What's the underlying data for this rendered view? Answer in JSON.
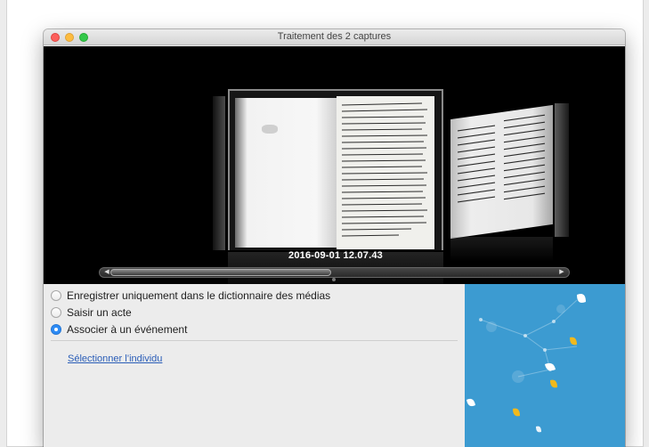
{
  "window": {
    "title": "Traitement des 2 captures"
  },
  "viewer": {
    "date_label": "2016-09-01 12.07.43"
  },
  "options": {
    "items": [
      {
        "label": "Enregistrer uniquement dans le dictionnaire des médias",
        "selected": false
      },
      {
        "label": "Saisir un acte",
        "selected": false
      },
      {
        "label": "Associer à un événement",
        "selected": true
      }
    ],
    "select_link": "Sélectionner l’individu"
  },
  "colors": {
    "accent": "#2d8bf5",
    "illustration_bg": "#3c9bd1",
    "leaf_yellow": "#f1b91c",
    "leaf_white": "#ffffff"
  },
  "icons": {
    "close": "close-dot",
    "minimize": "minimize-dot",
    "maximize": "maximize-dot",
    "scroll_left": "chevron-left-icon",
    "scroll_right": "chevron-right-icon"
  }
}
